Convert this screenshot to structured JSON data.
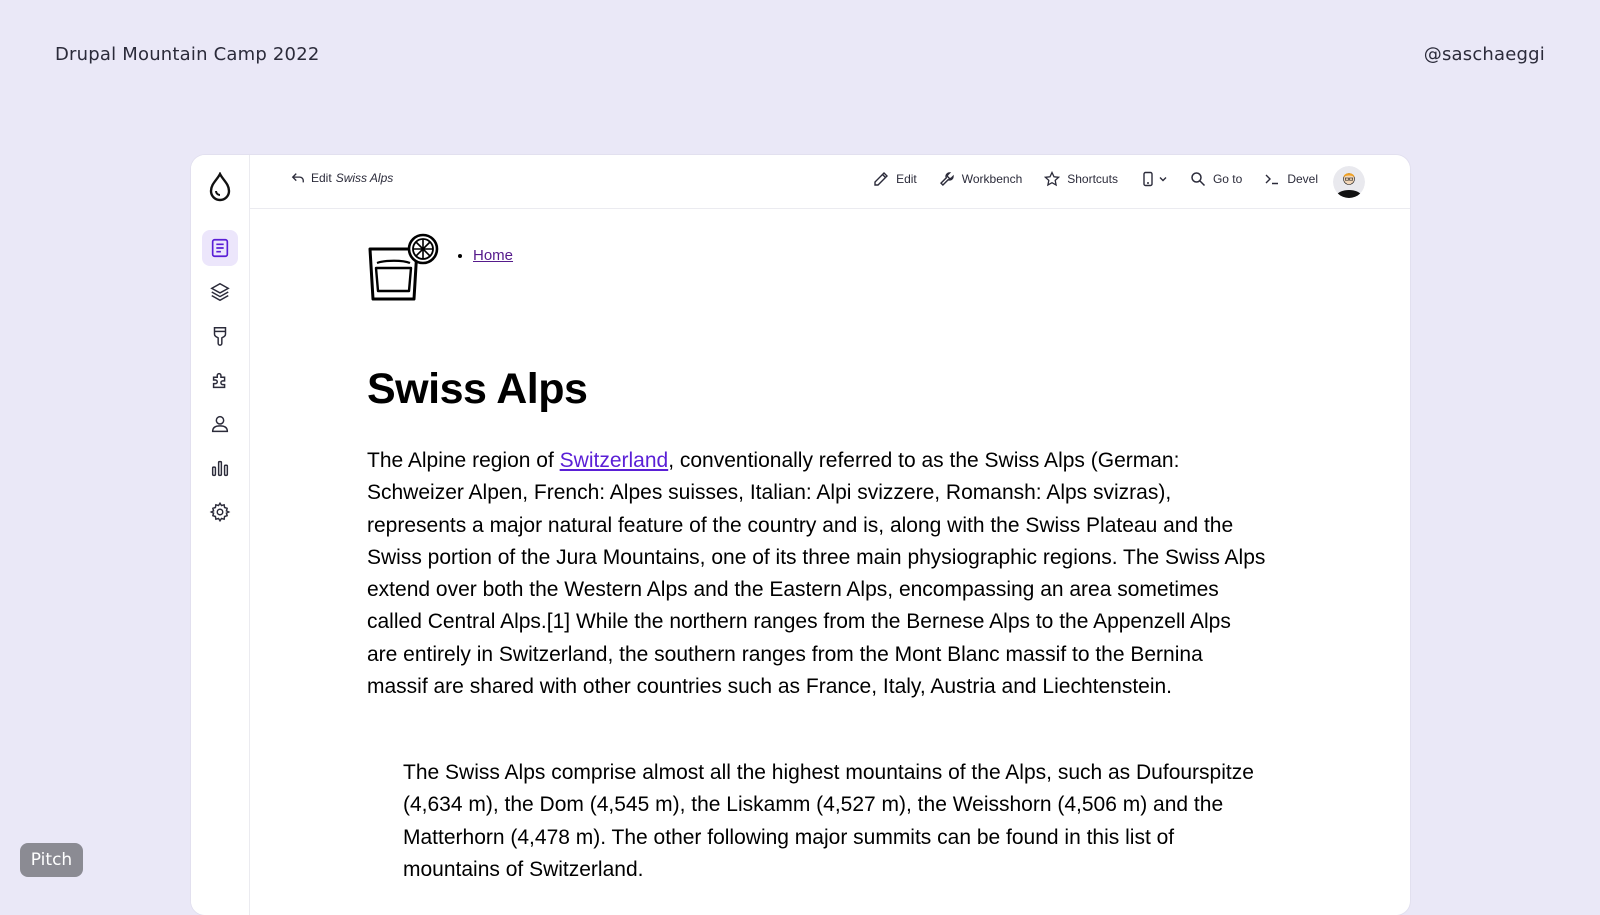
{
  "slide": {
    "title": "Drupal Mountain Camp 2022",
    "handle": "@saschaeggi",
    "badge": "Pitch"
  },
  "sidebar": {
    "items": [
      {
        "icon": "content-icon",
        "active": true
      },
      {
        "icon": "structure-icon",
        "active": false
      },
      {
        "icon": "appearance-icon",
        "active": false
      },
      {
        "icon": "extend-icon",
        "active": false
      },
      {
        "icon": "people-icon",
        "active": false
      },
      {
        "icon": "reports-icon",
        "active": false
      },
      {
        "icon": "configuration-icon",
        "active": false
      }
    ]
  },
  "topbar": {
    "edit_prefix": "Edit",
    "edit_title": "Swiss Alps",
    "tools": {
      "edit": "Edit",
      "workbench": "Workbench",
      "shortcuts": "Shortcuts",
      "goto": "Go to",
      "devel": "Devel"
    }
  },
  "page": {
    "nav_home": "Home",
    "title": "Swiss Alps",
    "intro_before": "The Alpine region of ",
    "intro_link": "Switzerland",
    "intro_after": ", conventionally referred to as the Swiss Alps (German: Schweizer Alpen, French: Alpes suisses, Italian: Alpi svizzere, Romansh: Alps svizras), represents a major natural feature of the country and is, along with the Swiss Plateau and the Swiss portion of the Jura Mountains, one of its three main physiographic regions. The Swiss Alps extend over both the Western Alps and the Eastern Alps, encompassing an area sometimes called Central Alps.[1] While the northern ranges from the Bernese Alps to the Appenzell Alps are entirely in Switzerland, the southern ranges from the Mont Blanc massif to the Bernina massif are shared with other countries such as France, Italy, Austria and Liechtenstein.",
    "quote": "The Swiss Alps comprise almost all the highest mountains of the Alps, such as Dufourspitze (4,634 m), the Dom (4,545 m), the Liskamm (4,527 m), the Weisshorn (4,506 m) and the Matterhorn (4,478 m). The other following major summits can be found in this list of mountains of Switzerland."
  },
  "colors": {
    "background": "#eae8f7",
    "accent": "#5a1fd6",
    "active_nav_bg": "#ece6fb"
  }
}
